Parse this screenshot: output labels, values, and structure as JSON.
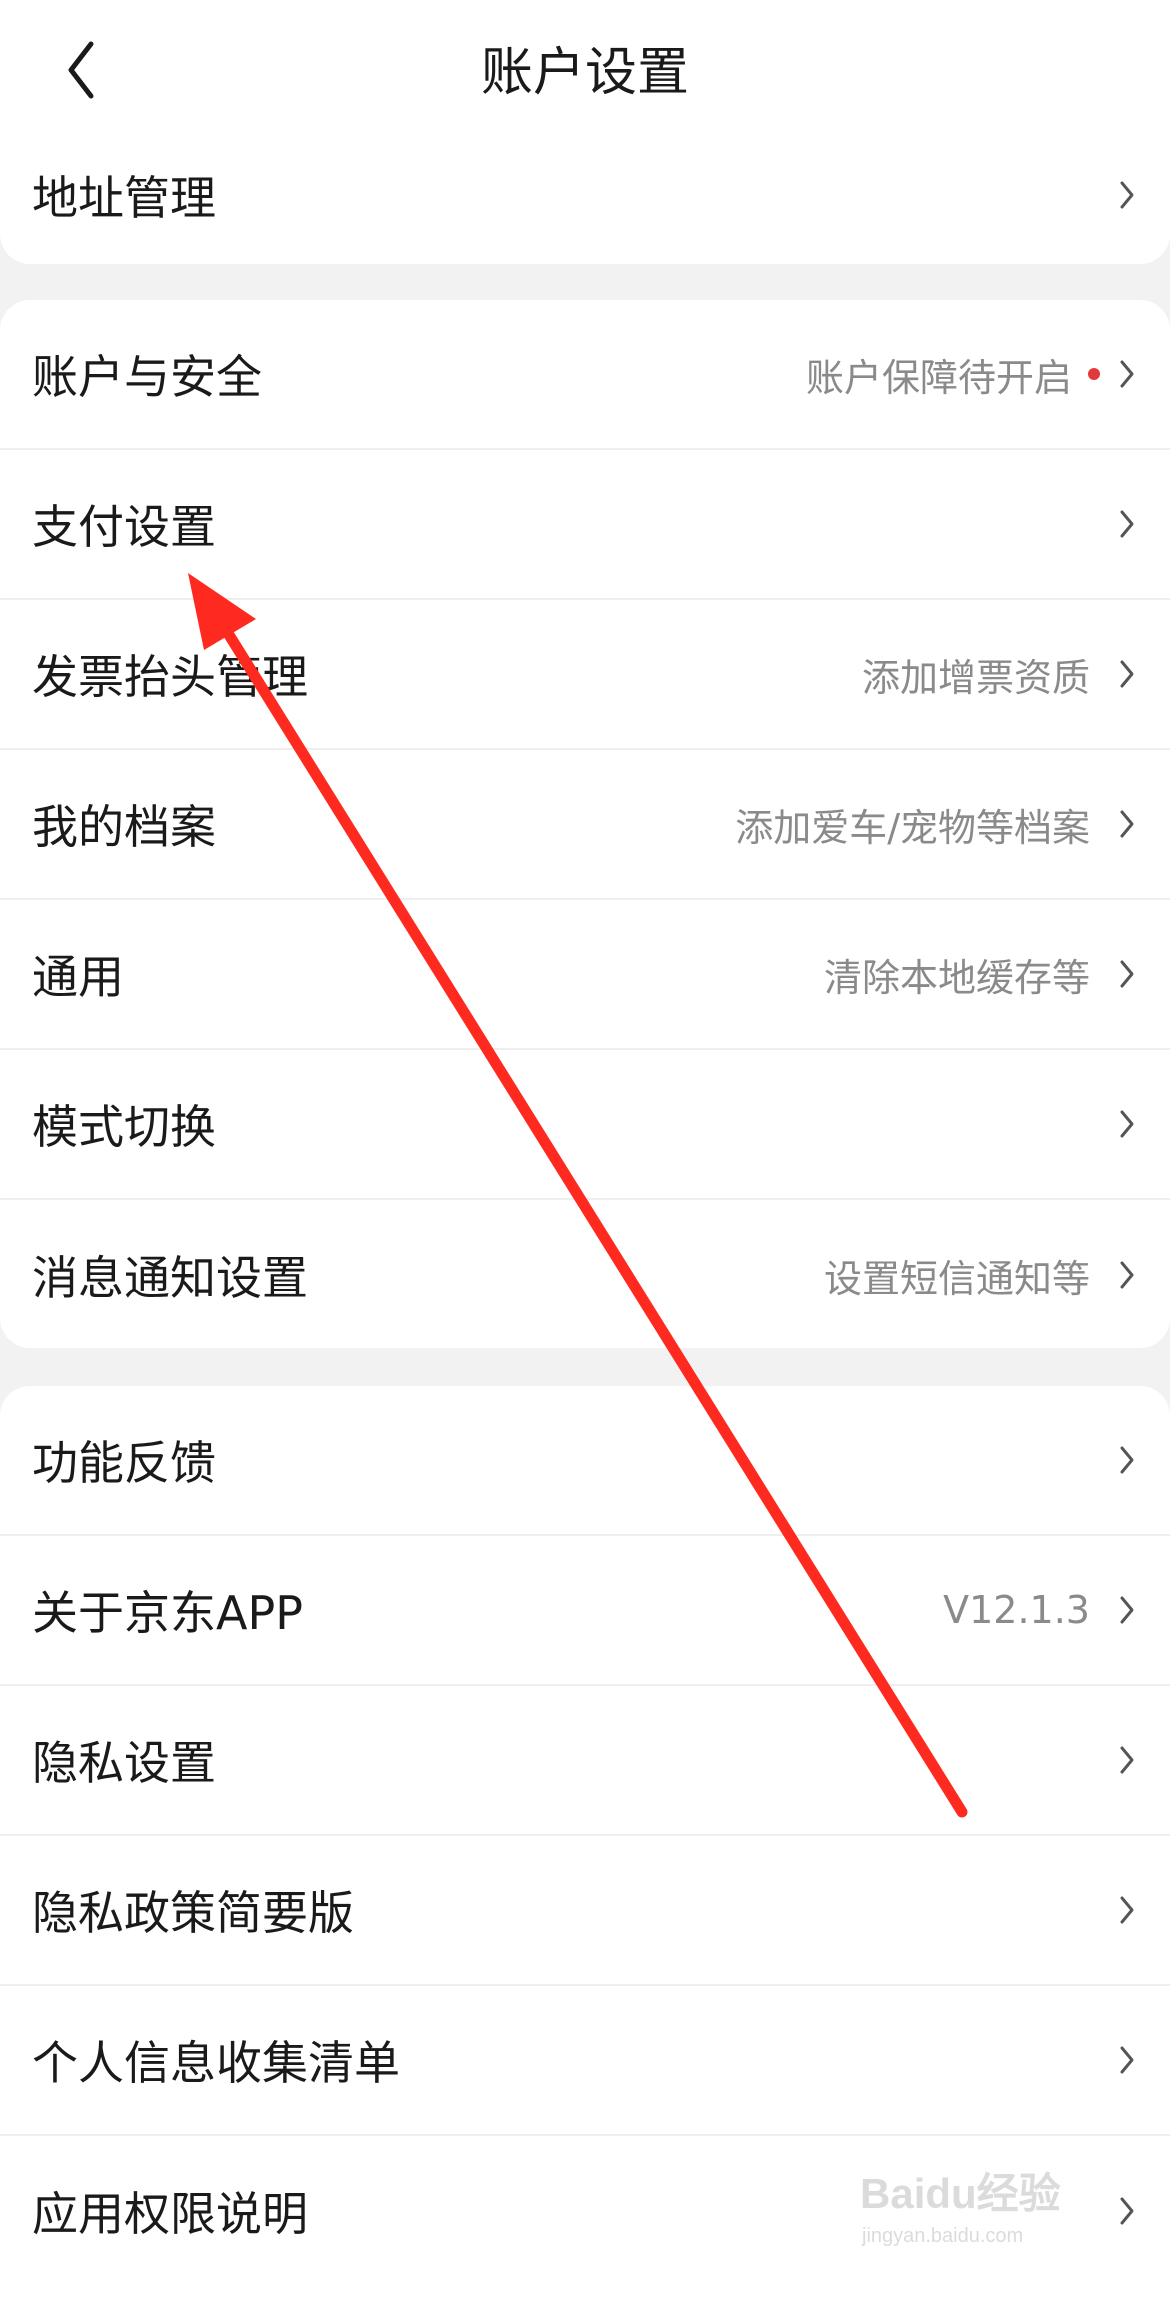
{
  "header": {
    "title": "账户设置"
  },
  "sections": [
    {
      "items": [
        {
          "label": "地址管理",
          "sub": ""
        }
      ]
    },
    {
      "items": [
        {
          "label": "账户与安全",
          "sub": "账户保障待开启",
          "dot": true
        },
        {
          "label": "支付设置",
          "sub": ""
        },
        {
          "label": "发票抬头管理",
          "sub": "添加增票资质"
        },
        {
          "label": "我的档案",
          "sub": "添加爱车/宠物等档案"
        },
        {
          "label": "通用",
          "sub": "清除本地缓存等"
        },
        {
          "label": "模式切换",
          "sub": ""
        },
        {
          "label": "消息通知设置",
          "sub": "设置短信通知等"
        }
      ]
    },
    {
      "items": [
        {
          "label": "功能反馈",
          "sub": ""
        },
        {
          "label": "关于京东APP",
          "sub": "V12.1.3"
        },
        {
          "label": "隐私设置",
          "sub": ""
        },
        {
          "label": "隐私政策简要版",
          "sub": ""
        },
        {
          "label": "个人信息收集清单",
          "sub": ""
        },
        {
          "label": "应用权限说明",
          "sub": ""
        }
      ]
    }
  ],
  "watermark": {
    "text": "Baidu经验",
    "url_text": "jingyan.baidu.com"
  },
  "colors": {
    "accent_red": "#e4393c",
    "annotation_arrow": "#ff2a1f",
    "label": "#1a1a1a",
    "sub_text": "#8a8a8a",
    "background": "#f2f2f2"
  }
}
